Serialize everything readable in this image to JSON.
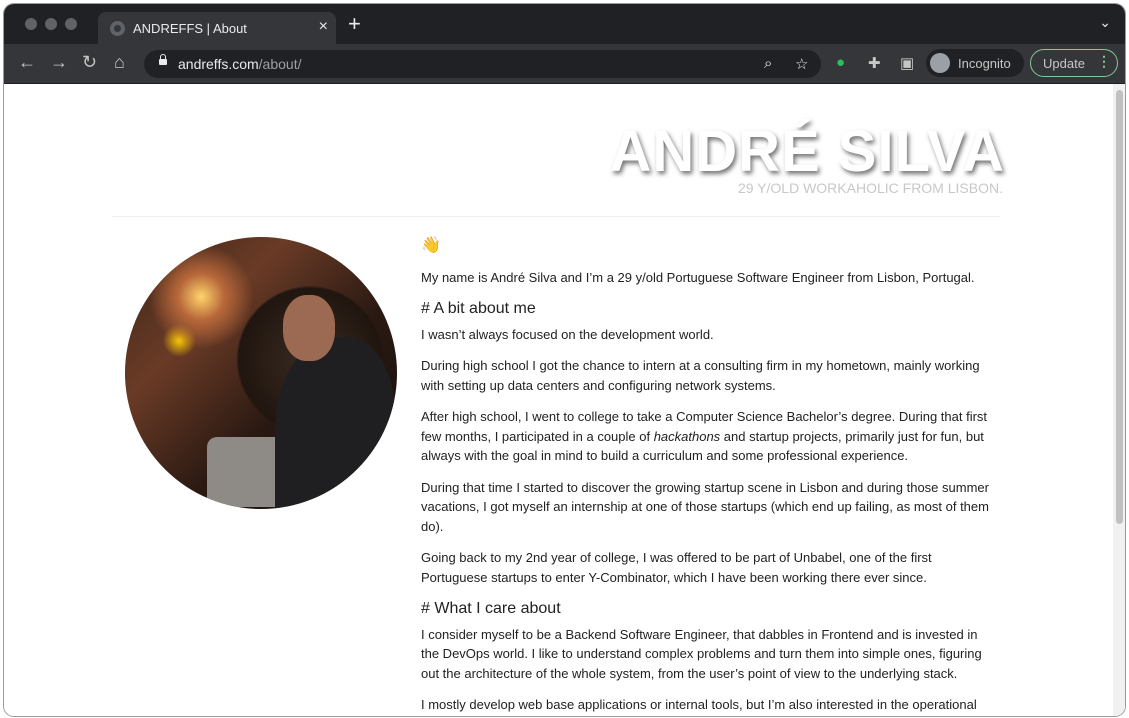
{
  "browser": {
    "tab_title": "ANDREFFS | About",
    "tab_close": "×",
    "new_tab": "+",
    "url_host": "andreffs.com",
    "url_path": "/about/",
    "incognito_label": "Incognito",
    "update_label": "Update",
    "nav_back": "←",
    "nav_forward": "→",
    "nav_reload": "↻",
    "nav_home": "⌂"
  },
  "header": {
    "name": "ANDRÉ SILVA",
    "subtitle": "29 Y/OLD WORKAHOLIC FROM LISBON."
  },
  "content": {
    "wave": "👋",
    "intro": "My name is André Silva and I’m a 29 y/old Portuguese Software Engineer from Lisbon, Portugal.",
    "about_heading": "# A bit about me",
    "p1": "I wasn’t always focused on the development world.",
    "p2": "During high school I got the chance to intern at a consulting firm in my hometown, mainly working with setting up data centers and configuring network systems.",
    "p3_before": "After high school, I went to college to take a Computer Science Bachelor’s degree. During that first few months, I participated in a couple of ",
    "p3_em": "hackathons",
    "p3_after": " and startup projects, primarily just for fun, but always with the goal in mind to build a curriculum and some professional experience.",
    "p4": "During that time I started to discover the growing startup scene in Lisbon and during those summer vacations, I got myself an internship at one of those startups (which end up failing, as most of them do).",
    "p5": "Going back to my 2nd year of college, I was offered to be part of Unbabel, one of the first Portuguese startups to enter Y-Combinator, which I have been working there ever since.",
    "care_heading": "# What I care about",
    "p6": "I consider myself to be a Backend Software Engineer, that dabbles in Frontend and is invested in the DevOps world. I like to understand complex problems and turn them into simple ones, figuring out the architecture of the whole system, from the user’s point of view to the underlying stack.",
    "p7": "I mostly develop web base applications or internal tools, but I’m also interested in the operational"
  }
}
